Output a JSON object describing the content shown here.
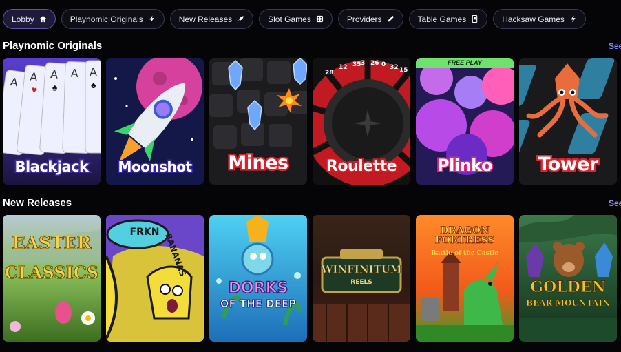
{
  "nav": {
    "pills": [
      {
        "label": "Lobby",
        "icon": "home-icon"
      },
      {
        "label": "Playnomic Originals",
        "icon": "lightning-icon"
      },
      {
        "label": "New Releases",
        "icon": "rocket-icon"
      },
      {
        "label": "Slot Games",
        "icon": "dice-icon"
      },
      {
        "label": "Providers",
        "icon": "pencil-icon"
      },
      {
        "label": "Table Games",
        "icon": "device-icon"
      },
      {
        "label": "Hacksaw Games",
        "icon": "lightning-icon"
      }
    ]
  },
  "sections": {
    "originals": {
      "title": "Playnomic Originals",
      "see_all": "See all",
      "cards": [
        {
          "title": "Blackjack"
        },
        {
          "title": "Moonshot"
        },
        {
          "title": "Mines"
        },
        {
          "title": "Roulette"
        },
        {
          "title": "Plinko",
          "banner": "FREE PLAY"
        },
        {
          "title": "Tower"
        }
      ]
    },
    "new_releases": {
      "title": "New Releases",
      "see_all": "See all",
      "cards": [
        {
          "title_line1": "EASTER",
          "title_line2": "CLASSICS"
        },
        {
          "title_line1": "FRKN",
          "title_line2": "BANANAS"
        },
        {
          "title_line1": "DORKS",
          "title_line2": "OF THE DEEP"
        },
        {
          "title_line1": "WINFINITUM",
          "title_line2": "REELS"
        },
        {
          "title_line1": "DRAGON FORTRESS",
          "title_line2": "Battle of the Castle"
        },
        {
          "title_line1": "GOLDEN",
          "title_line2": "BEAR MOUNTAIN"
        }
      ]
    }
  },
  "colors": {
    "accent": "#8e88ff",
    "background": "#050507",
    "free_play_banner": "#6fe26d"
  }
}
